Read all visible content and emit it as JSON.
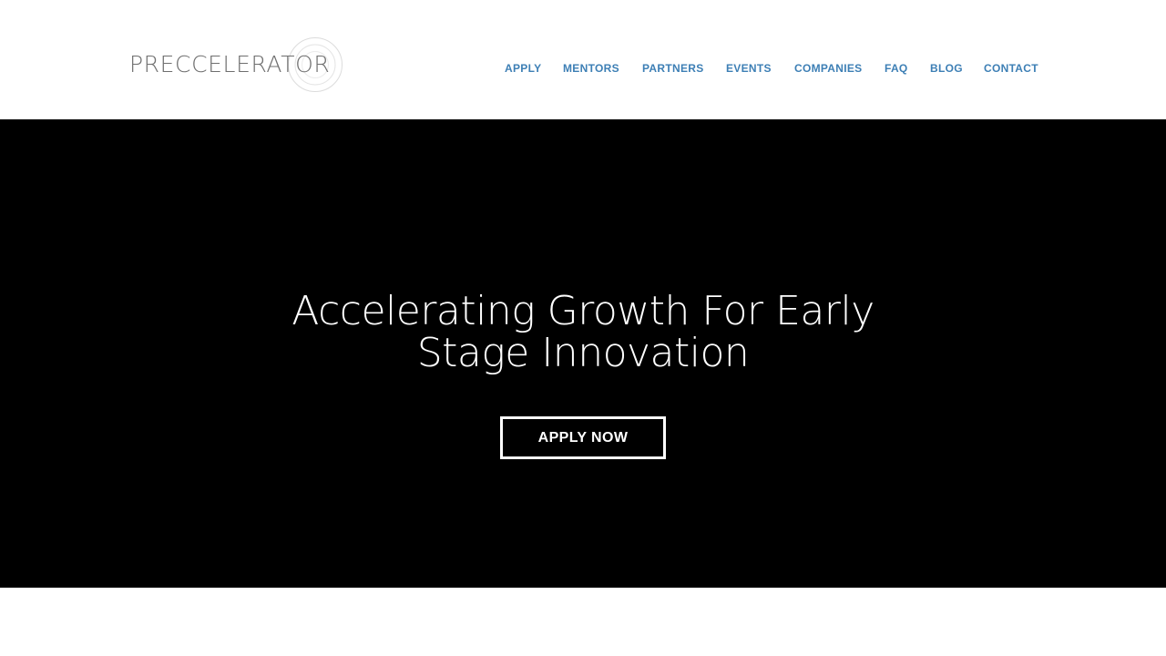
{
  "brand": {
    "logo_text": "PRECCELERATOR",
    "logo_icon": "concentric-rings-icon",
    "logo_color": "#6f6f6f"
  },
  "nav": {
    "items": [
      {
        "label": "APPLY"
      },
      {
        "label": "MENTORS"
      },
      {
        "label": "PARTNERS"
      },
      {
        "label": "EVENTS"
      },
      {
        "label": "COMPANIES"
      },
      {
        "label": "FAQ"
      },
      {
        "label": "BLOG"
      },
      {
        "label": "CONTACT"
      }
    ],
    "color": "#3d7fb5"
  },
  "hero": {
    "title_line1": "Accelerating Growth For Early",
    "title_line2": "Stage Innovation",
    "cta_label": "APPLY NOW",
    "background": "#000000",
    "text_color": "#ffffff"
  }
}
